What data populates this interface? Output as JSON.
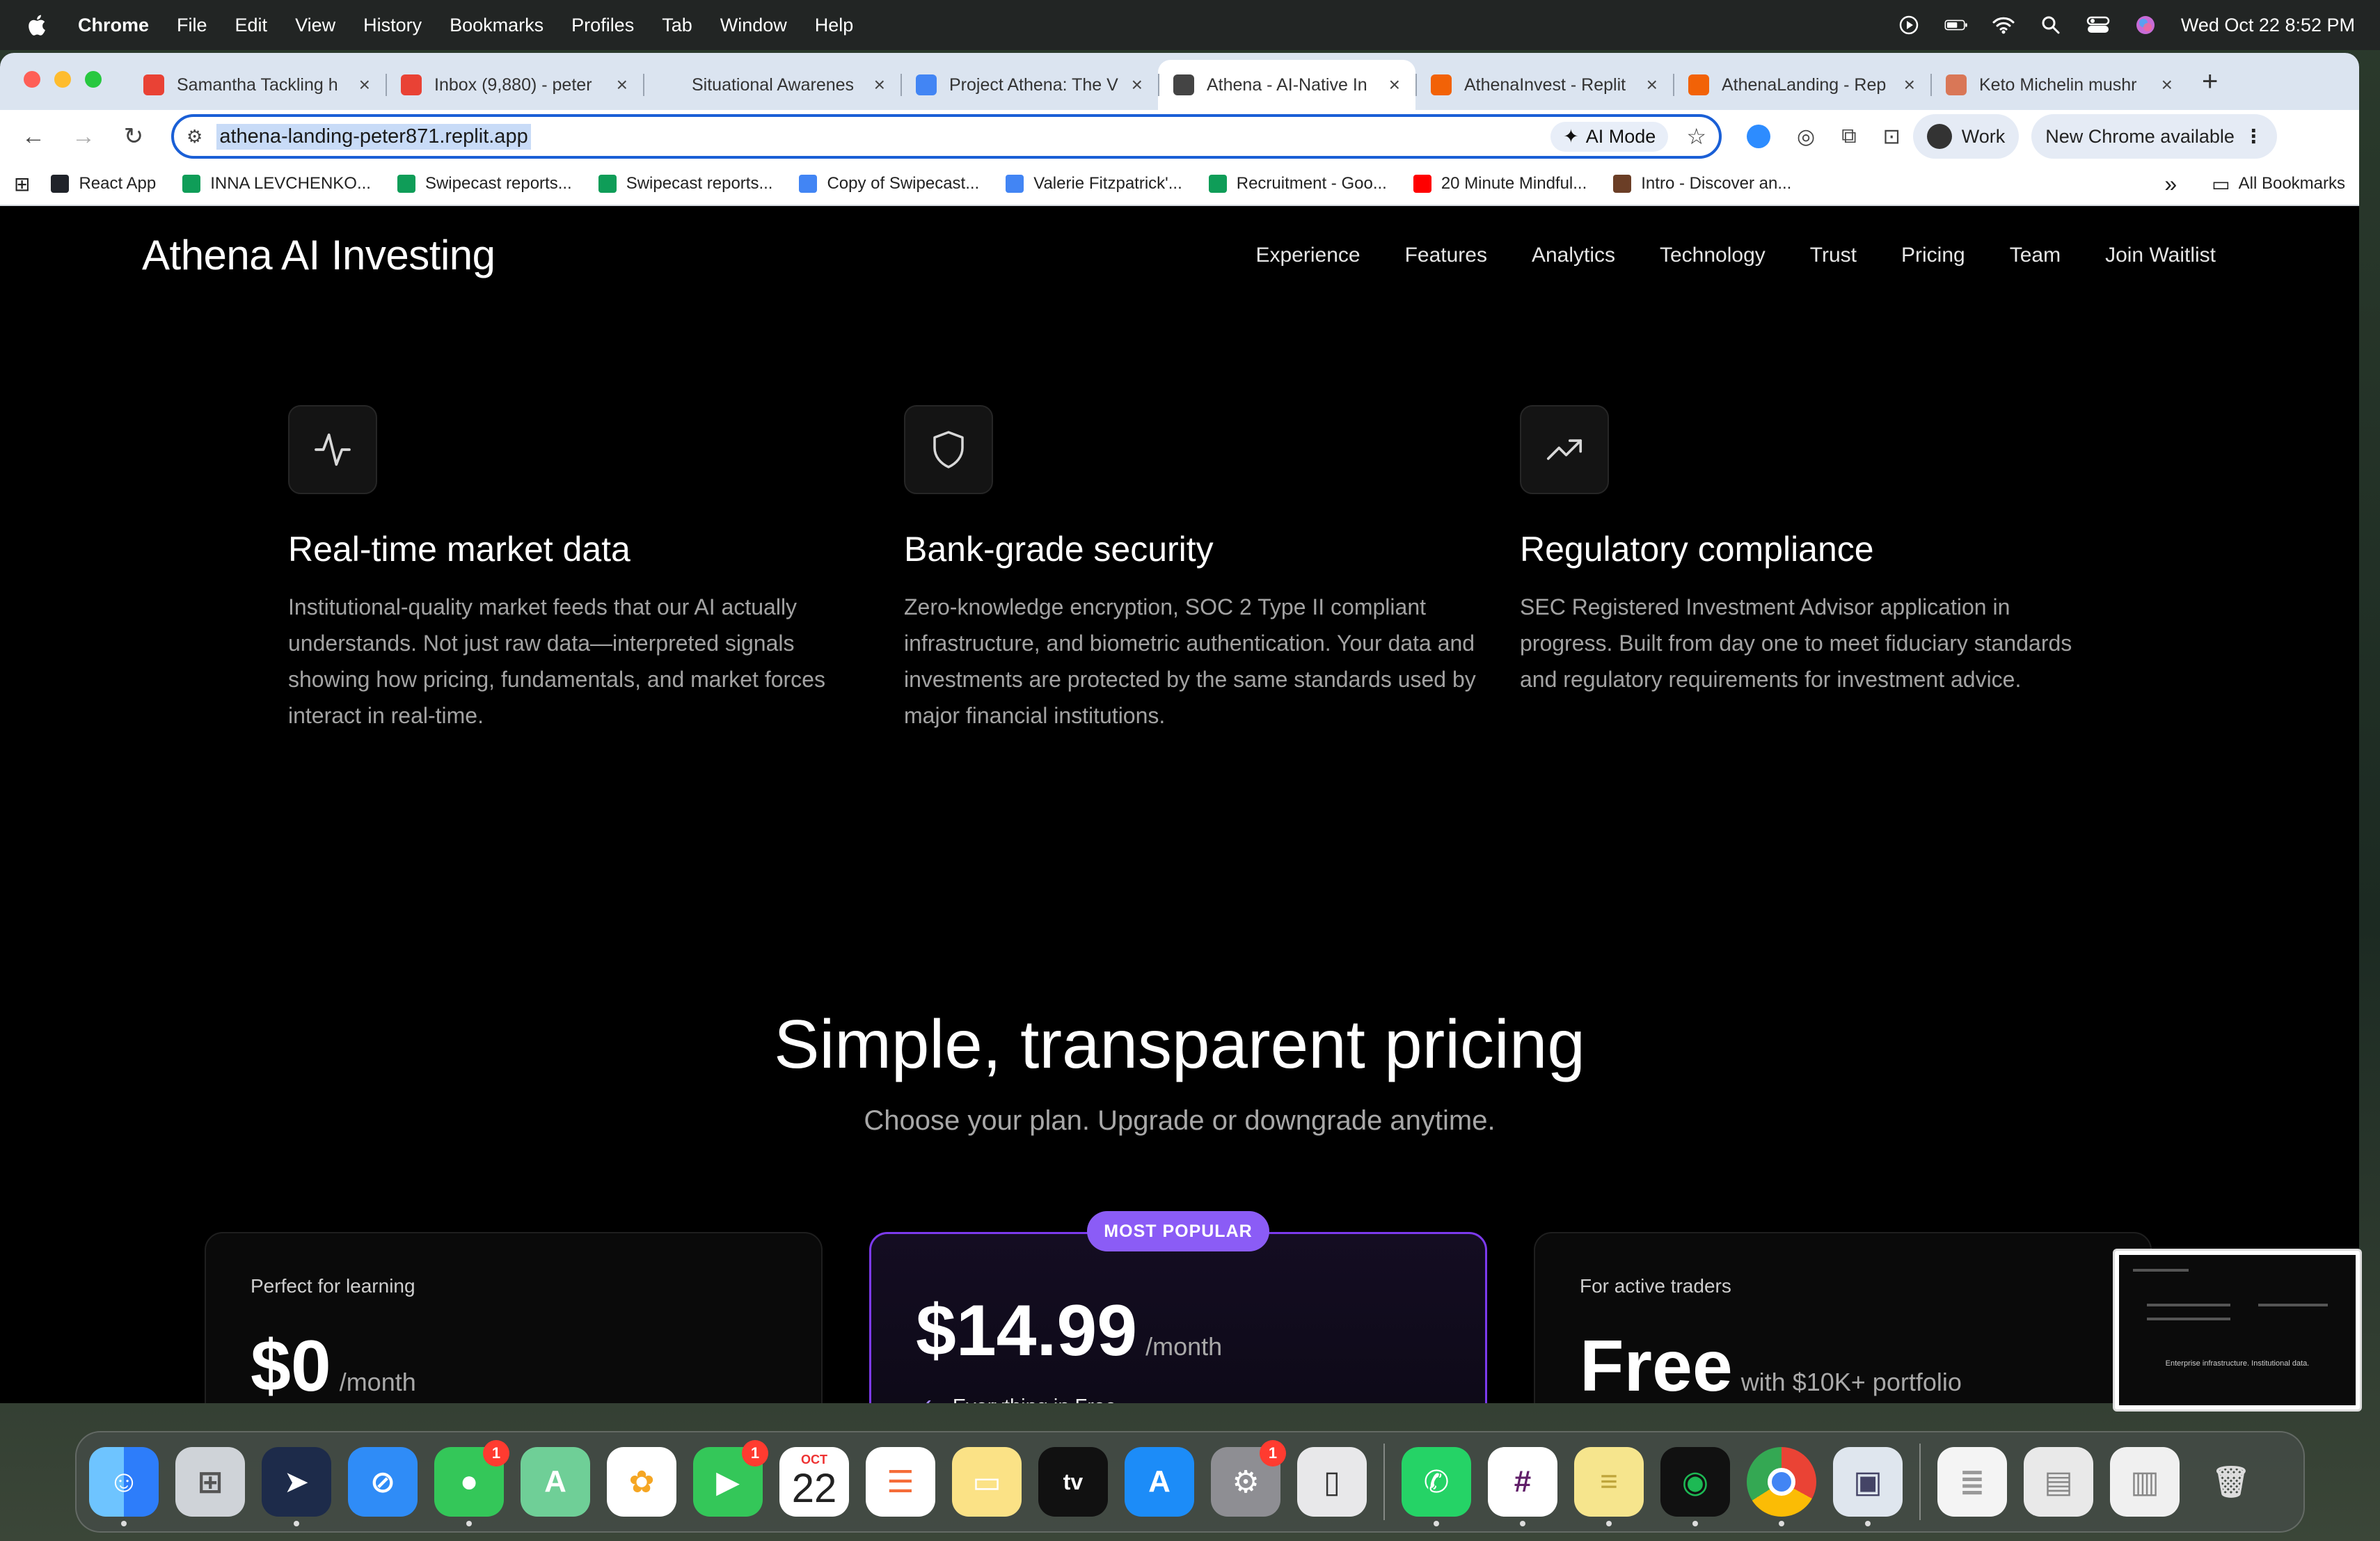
{
  "menubar": {
    "app": "Chrome",
    "items": [
      "File",
      "Edit",
      "View",
      "History",
      "Bookmarks",
      "Profiles",
      "Tab",
      "Window",
      "Help"
    ],
    "datetime": "Wed Oct 22  8:52 PM"
  },
  "tabs": [
    {
      "title": "Samantha Tackling h",
      "color": "#e94235"
    },
    {
      "title": "Inbox (9,880) - peter",
      "color": "#e94235"
    },
    {
      "title": "Situational Awarenes",
      "color": "#dbe4f0"
    },
    {
      "title": "Project Athena: The V",
      "color": "#4285f4"
    },
    {
      "title": "Athena - AI-Native In",
      "color": "#444444"
    },
    {
      "title": "AthenaInvest - Replit",
      "color": "#f26207"
    },
    {
      "title": "AthenaLanding - Rep",
      "color": "#f26207"
    },
    {
      "title": "Keto Michelin mushr",
      "color": "#d97757"
    }
  ],
  "toolbar": {
    "url": "athena-landing-peter871.replit.app",
    "ai_mode": "AI Mode",
    "profile": "Work",
    "update": "New Chrome available"
  },
  "bookmarks": {
    "items": [
      {
        "label": "React App",
        "color": "#61dafb"
      },
      {
        "label": "INNA LEVCHENKO...",
        "color": "#0f9d58"
      },
      {
        "label": "Swipecast reports...",
        "color": "#0f9d58"
      },
      {
        "label": "Swipecast reports...",
        "color": "#0f9d58"
      },
      {
        "label": "Copy of Swipecast...",
        "color": "#4285f4"
      },
      {
        "label": "Valerie Fitzpatrick'...",
        "color": "#4285f4"
      },
      {
        "label": "Recruitment - Goo...",
        "color": "#0f9d58"
      },
      {
        "label": "20 Minute Mindful...",
        "color": "#ff0000"
      },
      {
        "label": "Intro - Discover an...",
        "color": "#6b3e26"
      }
    ],
    "more": "»",
    "all": "All Bookmarks"
  },
  "page": {
    "brand": "Athena AI Investing",
    "nav": [
      "Experience",
      "Features",
      "Analytics",
      "Technology",
      "Trust",
      "Pricing",
      "Team",
      "Join Waitlist"
    ],
    "features": [
      {
        "icon": "activity-icon",
        "title": "Real-time market data",
        "text": "Institutional-quality market feeds that our AI actually understands. Not just raw data—interpreted signals showing how pricing, fundamentals, and market forces interact in real-time."
      },
      {
        "icon": "shield-icon",
        "title": "Bank-grade security",
        "text": "Zero-knowledge encryption, SOC 2 Type II compliant infrastructure, and biometric authentication. Your data and investments are protected by the same standards used by major financial institutions."
      },
      {
        "icon": "trending-up-icon",
        "title": "Regulatory compliance",
        "text": "SEC Registered Investment Advisor application in progress. Built from day one to meet fiduciary standards and regulatory requirements for investment advice."
      }
    ],
    "pricing_title": "Simple, transparent pricing",
    "pricing_subtitle": "Choose your plan. Upgrade or downgrade anytime.",
    "badge": "MOST POPULAR",
    "plans": [
      {
        "tagline": "Perfect for learning",
        "price": "$0",
        "period": "/month"
      },
      {
        "tagline": "",
        "price": "$14.99",
        "period": "/month",
        "feature": "Everything in Free"
      },
      {
        "tagline": "For active traders",
        "price": "Free",
        "period": "with $10K+ portfolio"
      }
    ]
  },
  "thumbnail": {
    "caption": "Enterprise infrastructure. Institutional data."
  },
  "dock": {
    "apps": [
      "Finder",
      "Launchpad",
      "Spark",
      "Safari",
      "Messages",
      "Maps",
      "Photos",
      "FaceTime",
      "Calendar",
      "Reminders",
      "Notes",
      "TV",
      "App Store",
      "System Settings",
      "iPhone Mirroring",
      "WhatsApp",
      "Slack",
      "Stickies",
      "Spotify",
      "Chrome",
      "Preview"
    ],
    "calendar_month": "OCT",
    "calendar_day": "22",
    "badges": {
      "messages": "1",
      "facetime": "1",
      "settings": "1"
    }
  }
}
